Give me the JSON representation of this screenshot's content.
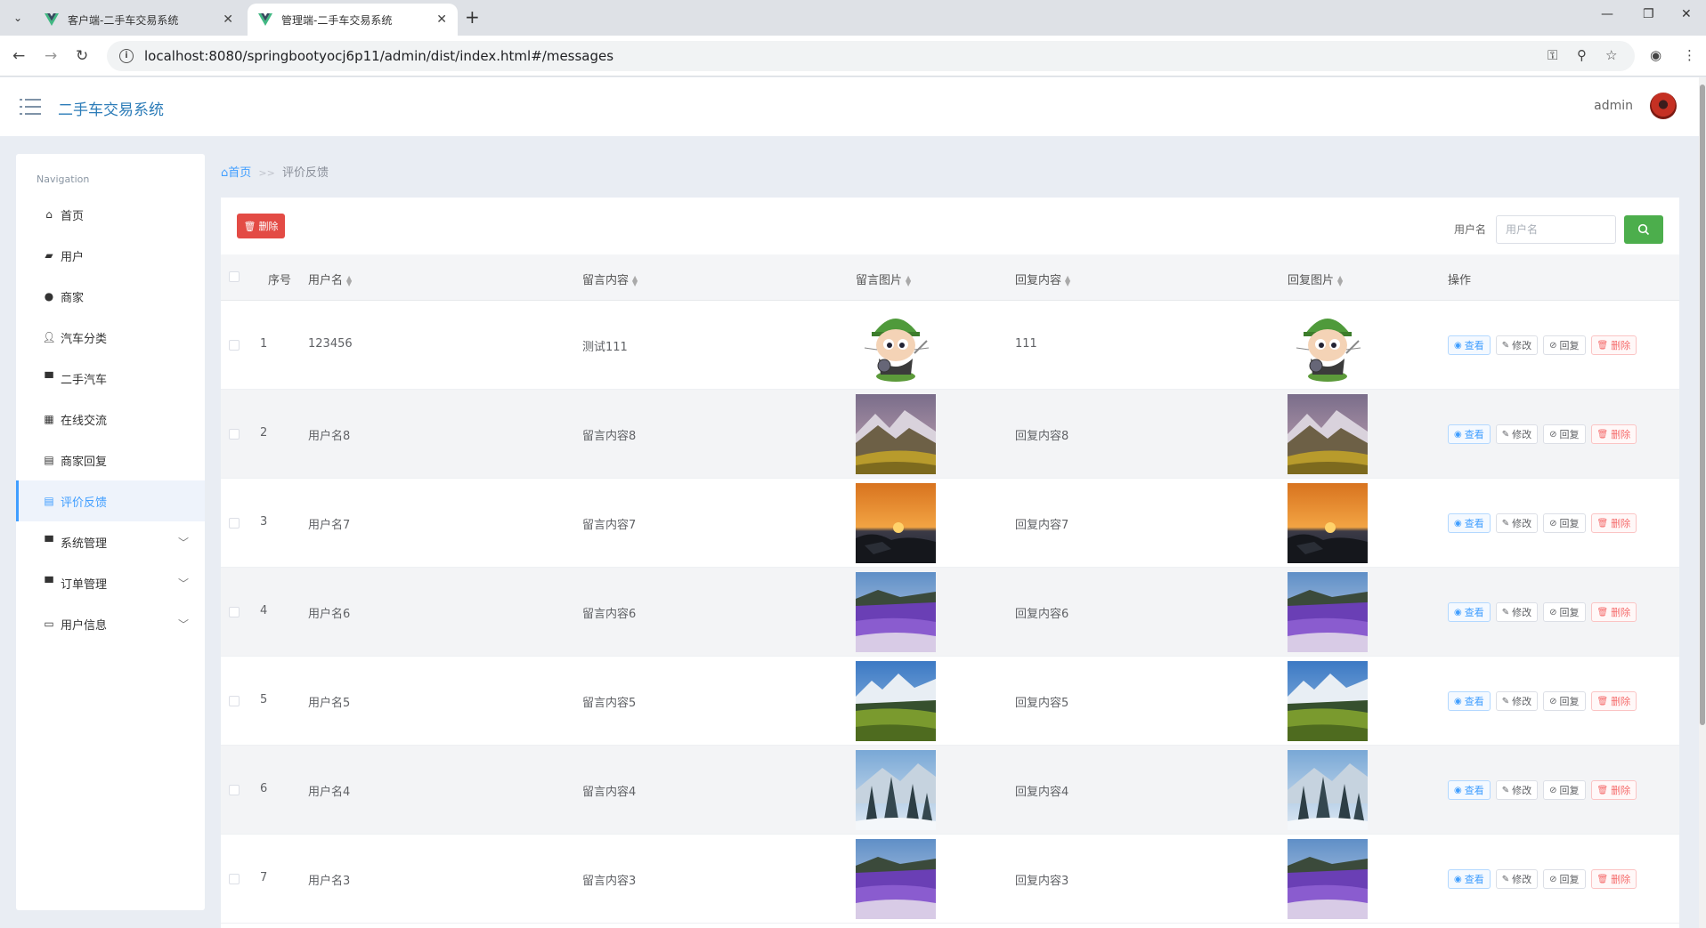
{
  "browser": {
    "tabs": [
      {
        "title": "客户端-二手车交易系统",
        "active": false
      },
      {
        "title": "管理端-二手车交易系统",
        "active": true
      }
    ],
    "url": "localhost:8080/springbootyocj6p11/admin/dist/index.html#/messages"
  },
  "header": {
    "app_title": "二手车交易系统",
    "user": "admin"
  },
  "sidebar": {
    "caption": "Navigation",
    "items": [
      {
        "label": "首页",
        "icon": "home-icon"
      },
      {
        "label": "用户",
        "icon": "briefcase-icon"
      },
      {
        "label": "商家",
        "icon": "globe-icon"
      },
      {
        "label": "汽车分类",
        "icon": "user-icon"
      },
      {
        "label": "二手汽车",
        "icon": "monitor-icon"
      },
      {
        "label": "在线交流",
        "icon": "grid-icon"
      },
      {
        "label": "商家回复",
        "icon": "comment-icon"
      },
      {
        "label": "评价反馈",
        "icon": "clipboard-icon",
        "active": true
      },
      {
        "label": "系统管理",
        "icon": "computer-icon",
        "expandable": true
      },
      {
        "label": "订单管理",
        "icon": "desktop-icon",
        "expandable": true
      },
      {
        "label": "用户信息",
        "icon": "card-icon",
        "expandable": true
      }
    ]
  },
  "breadcrumb": {
    "home": "首页",
    "separator": ">>",
    "current": "评价反馈"
  },
  "toolbar": {
    "delete_label": "删除",
    "search_label": "用户名",
    "search_placeholder": "用户名"
  },
  "table": {
    "columns": [
      "序号",
      "用户名",
      "留言内容",
      "留言图片",
      "回复内容",
      "回复图片",
      "操作"
    ],
    "actions": {
      "view": "查看",
      "edit": "修改",
      "reply": "回复",
      "delete": "删除"
    },
    "rows": [
      {
        "index": "1",
        "username": "123456",
        "content": "测试111",
        "image": "cartoon-octocat",
        "reply": "111",
        "reply_image": "cartoon-octocat"
      },
      {
        "index": "2",
        "username": "用户名8",
        "content": "留言内容8",
        "image": "mountain-valley",
        "reply": "回复内容8",
        "reply_image": "mountain-valley"
      },
      {
        "index": "3",
        "username": "用户名7",
        "content": "留言内容7",
        "image": "sunset-sea",
        "reply": "回复内容7",
        "reply_image": "sunset-sea"
      },
      {
        "index": "4",
        "username": "用户名6",
        "content": "留言内容6",
        "image": "lavender-field",
        "reply": "回复内容6",
        "reply_image": "lavender-field"
      },
      {
        "index": "5",
        "username": "用户名5",
        "content": "留言内容5",
        "image": "alpine-meadow",
        "reply": "回复内容5",
        "reply_image": "alpine-meadow"
      },
      {
        "index": "6",
        "username": "用户名4",
        "content": "留言内容4",
        "image": "snowy-forest",
        "reply": "回复内容4",
        "reply_image": "snowy-forest"
      },
      {
        "index": "7",
        "username": "用户名3",
        "content": "留言内容3",
        "image": "lavender-field",
        "reply": "回复内容3",
        "reply_image": "lavender-field"
      }
    ]
  },
  "colors": {
    "accent": "#409eff",
    "title_blue": "#2c7cb8",
    "danger": "#e34b45",
    "success": "#4cae4c"
  }
}
